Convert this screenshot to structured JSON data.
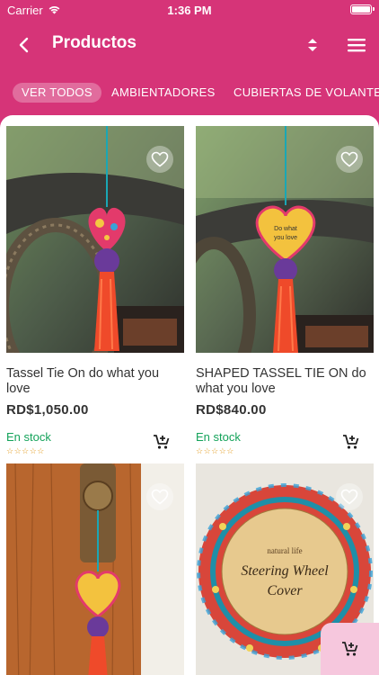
{
  "status_bar": {
    "carrier": "Carrier",
    "time": "1:36 PM"
  },
  "nav": {
    "title": "Productos"
  },
  "tabs": [
    {
      "label": "VER TODOS",
      "active": true
    },
    {
      "label": "AMBIENTADORES",
      "active": false
    },
    {
      "label": "CUBIERTAS DE VOLANTE",
      "active": false
    }
  ],
  "products": [
    {
      "name": "Tassel Tie On do what you love",
      "price": "RD$1,050.00",
      "stock": "En stock",
      "stars": "☆☆☆☆☆"
    },
    {
      "name": "SHAPED TASSEL TIE ON do what you love",
      "price": "RD$840.00",
      "stock": "En stock",
      "stars": "☆☆☆☆☆"
    },
    {
      "name": "",
      "price": "",
      "stock": "",
      "stars": ""
    },
    {
      "name": "",
      "price": "",
      "stock": "",
      "stars": ""
    }
  ],
  "colors": {
    "brand": "#d63478",
    "stock": "#14a35a",
    "stars": "#e39b1e",
    "float_cart_bg": "#f6c7dd"
  },
  "icons": [
    "wifi-icon",
    "battery-icon",
    "back-chevron-icon",
    "sort-icon",
    "menu-icon",
    "heart-icon",
    "add-to-cart-icon"
  ]
}
